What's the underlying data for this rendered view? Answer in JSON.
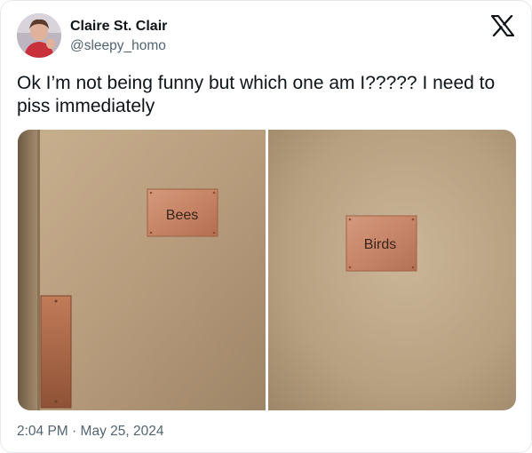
{
  "tweet": {
    "author_name": "Claire St. Clair",
    "author_handle": "@sleepy_homo",
    "text": "Ok I’m not being funny but which one am I????? I need to piss immediately",
    "time": "2:04 PM",
    "separator": "·",
    "date": "May 25, 2024"
  },
  "media": {
    "left_sign": "Bees",
    "right_sign": "Birds"
  },
  "icons": {
    "platform_logo": "x-logo-icon",
    "avatar": "profile-photo"
  },
  "colors": {
    "text_primary": "#0f1419",
    "text_secondary": "#536471",
    "border": "#e6e9ec",
    "plaque": "#c9846a"
  }
}
